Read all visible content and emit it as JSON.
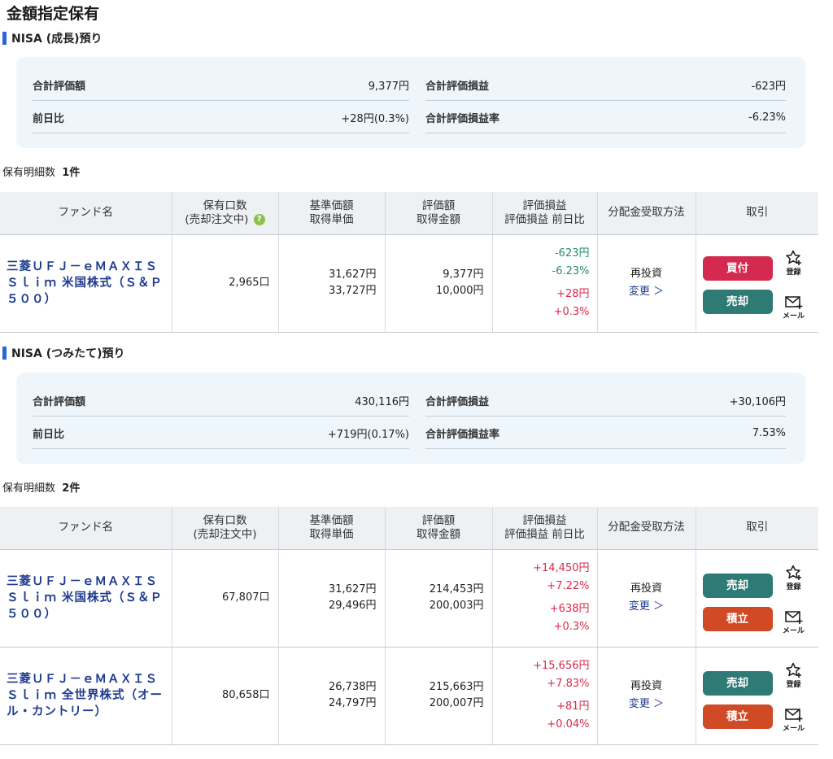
{
  "page_title": "金額指定保有",
  "sections": [
    {
      "header": "NISA (成長)預り",
      "summary": {
        "total_value_label": "合計評価額",
        "total_value": "9,377円",
        "pl_label": "合計評価損益",
        "pl": "-623円",
        "day_change_label": "前日比",
        "day_change": "+28円(0.3%)",
        "pl_rate_label": "合計評価損益率",
        "pl_rate": "-6.23%"
      },
      "count_label": "保有明細数",
      "count": "1件",
      "table_headers": {
        "fund": "ファンド名",
        "units_1": "保有口数",
        "units_2": "(売却注文中)",
        "nav_1": "基準価額",
        "nav_2": "取得単価",
        "value_1": "評価額",
        "value_2": "取得金額",
        "pl_1": "評価損益",
        "pl_2": "評価損益 前日比",
        "dist": "分配金受取方法",
        "trade": "取引"
      },
      "rows": [
        {
          "fund_name": "三菱ＵＦＪ－ｅＭＡＸＩＳ Ｓｌｉｍ 米国株式（Ｓ＆Ｐ５００）",
          "units": "2,965口",
          "nav": "31,627円",
          "cost_price": "33,727円",
          "value": "9,377円",
          "cost": "10,000円",
          "pl": "-623円",
          "pl_rate": "-6.23%",
          "day": "+28円",
          "day_rate": "+0.3%",
          "dist": "再投資",
          "change": "変更 ＞",
          "btn1": "買付",
          "btn2": "売却",
          "reg": "登録",
          "mail": "メール"
        }
      ]
    },
    {
      "header": "NISA (つみたて)預り",
      "summary": {
        "total_value_label": "合計評価額",
        "total_value": "430,116円",
        "pl_label": "合計評価損益",
        "pl": "+30,106円",
        "day_change_label": "前日比",
        "day_change": "+719円(0.17%)",
        "pl_rate_label": "合計評価損益率",
        "pl_rate": "7.53%"
      },
      "count_label": "保有明細数",
      "count": "2件",
      "table_headers": {
        "fund": "ファンド名",
        "units_1": "保有口数",
        "units_2": "(売却注文中)",
        "nav_1": "基準価額",
        "nav_2": "取得単価",
        "value_1": "評価額",
        "value_2": "取得金額",
        "pl_1": "評価損益",
        "pl_2": "評価損益 前日比",
        "dist": "分配金受取方法",
        "trade": "取引"
      },
      "rows": [
        {
          "fund_name": "三菱ＵＦＪ－ｅＭＡＸＩＳ Ｓｌｉｍ 米国株式（Ｓ＆Ｐ５００）",
          "units": "67,807口",
          "nav": "31,627円",
          "cost_price": "29,496円",
          "value": "214,453円",
          "cost": "200,003円",
          "pl": "+14,450円",
          "pl_rate": "+7.22%",
          "day": "+638円",
          "day_rate": "+0.3%",
          "dist": "再投資",
          "change": "変更 ＞",
          "btn1": "売却",
          "btn2": "積立",
          "reg": "登録",
          "mail": "メール"
        },
        {
          "fund_name": "三菱ＵＦＪ－ｅＭＡＸＩＳ Ｓｌｉｍ 全世界株式（オール・カントリー）",
          "units": "80,658口",
          "nav": "26,738円",
          "cost_price": "24,797円",
          "value": "215,663円",
          "cost": "200,007円",
          "pl": "+15,656円",
          "pl_rate": "+7.83%",
          "day": "+81円",
          "day_rate": "+0.04%",
          "dist": "再投資",
          "change": "変更 ＞",
          "btn1": "売却",
          "btn2": "積立",
          "reg": "登録",
          "mail": "メール"
        }
      ]
    }
  ],
  "colors": {
    "negative": "#2a8a6b",
    "positive": "#d8294d",
    "buy": "#d52a4f",
    "sell": "#2e7a74",
    "tsumitate": "#cf4a25",
    "accent_bar": "#2b63d9"
  }
}
